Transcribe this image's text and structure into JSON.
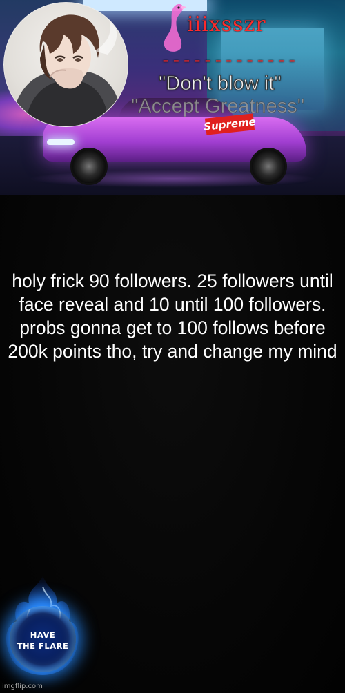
{
  "header": {
    "username": "iiixsszr",
    "divider": "-------------",
    "quote_primary": "\"Don't blow it\"",
    "quote_secondary": "\"Accept Greatness\"",
    "car_logo_text": "Supreme"
  },
  "post": {
    "text": "holy frick 90 followers. 25 followers until face reveal and 10 until 100 followers. probs gonna get to 100 follows before 200k points tho, try and change my mind"
  },
  "badge": {
    "line1": "HAVE",
    "line2": "THE FLARE"
  },
  "watermark": "imgflip.com",
  "colors": {
    "username": "#ff2a2a",
    "body_background": "#050505",
    "post_text": "#ffffff",
    "car_accent": "#b04de0",
    "flare_glow": "#2a8cff"
  }
}
